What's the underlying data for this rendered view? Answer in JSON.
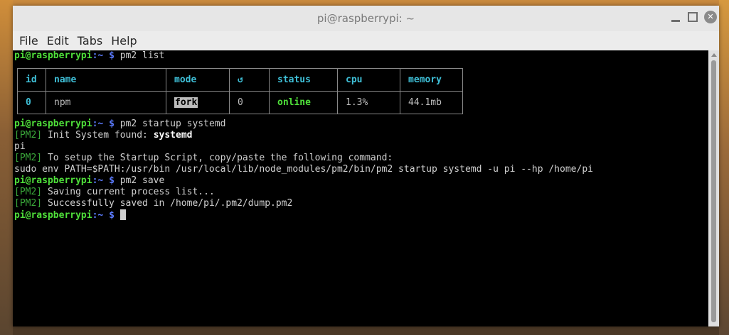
{
  "window": {
    "title": "pi@raspberrypi: ~"
  },
  "menu": [
    "File",
    "Edit",
    "Tabs",
    "Help"
  ],
  "prompt": {
    "user": "pi@raspberrypi",
    "sep": ":",
    "dir": "~",
    "symbol": "$"
  },
  "commands": {
    "c1": " pm2 list",
    "c2": " pm2 startup systemd",
    "c3": " pm2 save"
  },
  "table": {
    "headers": [
      "id",
      "name",
      "mode",
      "↺",
      "status",
      "cpu",
      "memory"
    ],
    "row": [
      "0",
      "npm",
      "fork",
      "0",
      "online",
      "1.3%",
      "44.1mb"
    ]
  },
  "output": {
    "tag": "[PM2]",
    "init_text": " Init System found: ",
    "init_value": "systemd",
    "pi_line": "pi",
    "setup_text": " To setup the Startup Script, copy/paste the following command:",
    "sudo_line": "sudo env PATH=$PATH:/usr/bin /usr/local/lib/node_modules/pm2/bin/pm2 startup systemd -u pi --hp /home/pi",
    "saving_text": " Saving current process list...",
    "saved_text": " Successfully saved in /home/pi/.pm2/dump.pm2"
  },
  "colors": {
    "prompt_user": "#4fe03a",
    "prompt_path": "#5c7cff",
    "table_header": "#3fc0d8",
    "status_online": "#4fe03a"
  }
}
